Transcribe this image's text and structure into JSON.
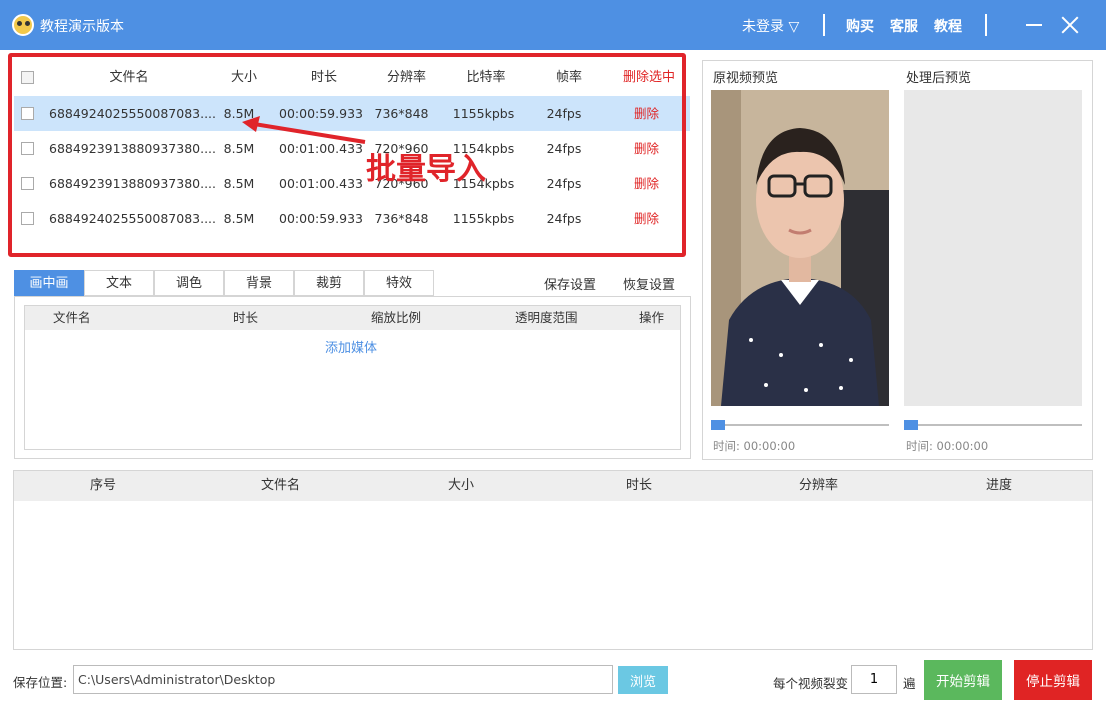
{
  "titlebar": {
    "title": "教程演示版本",
    "login": "未登录 ▽",
    "buy": "购买",
    "service": "客服",
    "tutorial": "教程"
  },
  "file_table": {
    "headers": [
      "文件名",
      "大小",
      "时长",
      "分辨率",
      "比特率",
      "帧率",
      "删除选中"
    ],
    "rows": [
      {
        "name": "6884924025550087083....",
        "size": "8.5M",
        "duration": "00:00:59.933",
        "resolution": "736*848",
        "bitrate": "1155kpbs",
        "fps": "24fps",
        "action": "删除"
      },
      {
        "name": "6884923913880937380....",
        "size": "8.5M",
        "duration": "00:01:00.433",
        "resolution": "720*960",
        "bitrate": "1154kpbs",
        "fps": "24fps",
        "action": "删除"
      },
      {
        "name": "6884923913880937380....",
        "size": "8.5M",
        "duration": "00:01:00.433",
        "resolution": "720*960",
        "bitrate": "1154kpbs",
        "fps": "24fps",
        "action": "删除"
      },
      {
        "name": "6884924025550087083....",
        "size": "8.5M",
        "duration": "00:00:59.933",
        "resolution": "736*848",
        "bitrate": "1155kpbs",
        "fps": "24fps",
        "action": "删除"
      }
    ],
    "selected_row": 0
  },
  "annotation": "批量导入",
  "tabs": [
    "画中画",
    "文本",
    "调色",
    "背景",
    "裁剪",
    "特效"
  ],
  "active_tab": "画中画",
  "settings": {
    "save": "保存设置",
    "restore": "恢复设置"
  },
  "pip_table": {
    "headers": [
      "文件名",
      "时长",
      "缩放比例",
      "透明度范围",
      "操作"
    ],
    "add_media": "添加媒体"
  },
  "preview": {
    "original_label": "原视频预览",
    "processed_label": "处理后预览",
    "time_original": "时间: 00:00:00",
    "time_processed": "时间: 00:00:00"
  },
  "queue_table": {
    "headers": [
      "序号",
      "文件名",
      "大小",
      "时长",
      "分辨率",
      "进度"
    ]
  },
  "bottom": {
    "save_label": "保存位置:",
    "save_path": "C:\\Users\\Administrator\\Desktop",
    "browse": "浏览",
    "split_label": "每个视频裂变",
    "split_count": "1",
    "split_unit": "遍",
    "start": "开始剪辑",
    "stop": "停止剪辑"
  },
  "colors": {
    "titlebar": "#4e90e3",
    "accent": "#4e90e3",
    "delete_red": "#e02424",
    "highlight_red": "#e0242a",
    "start_green": "#5bb85d",
    "browse_cyan": "#6bc8e3"
  }
}
